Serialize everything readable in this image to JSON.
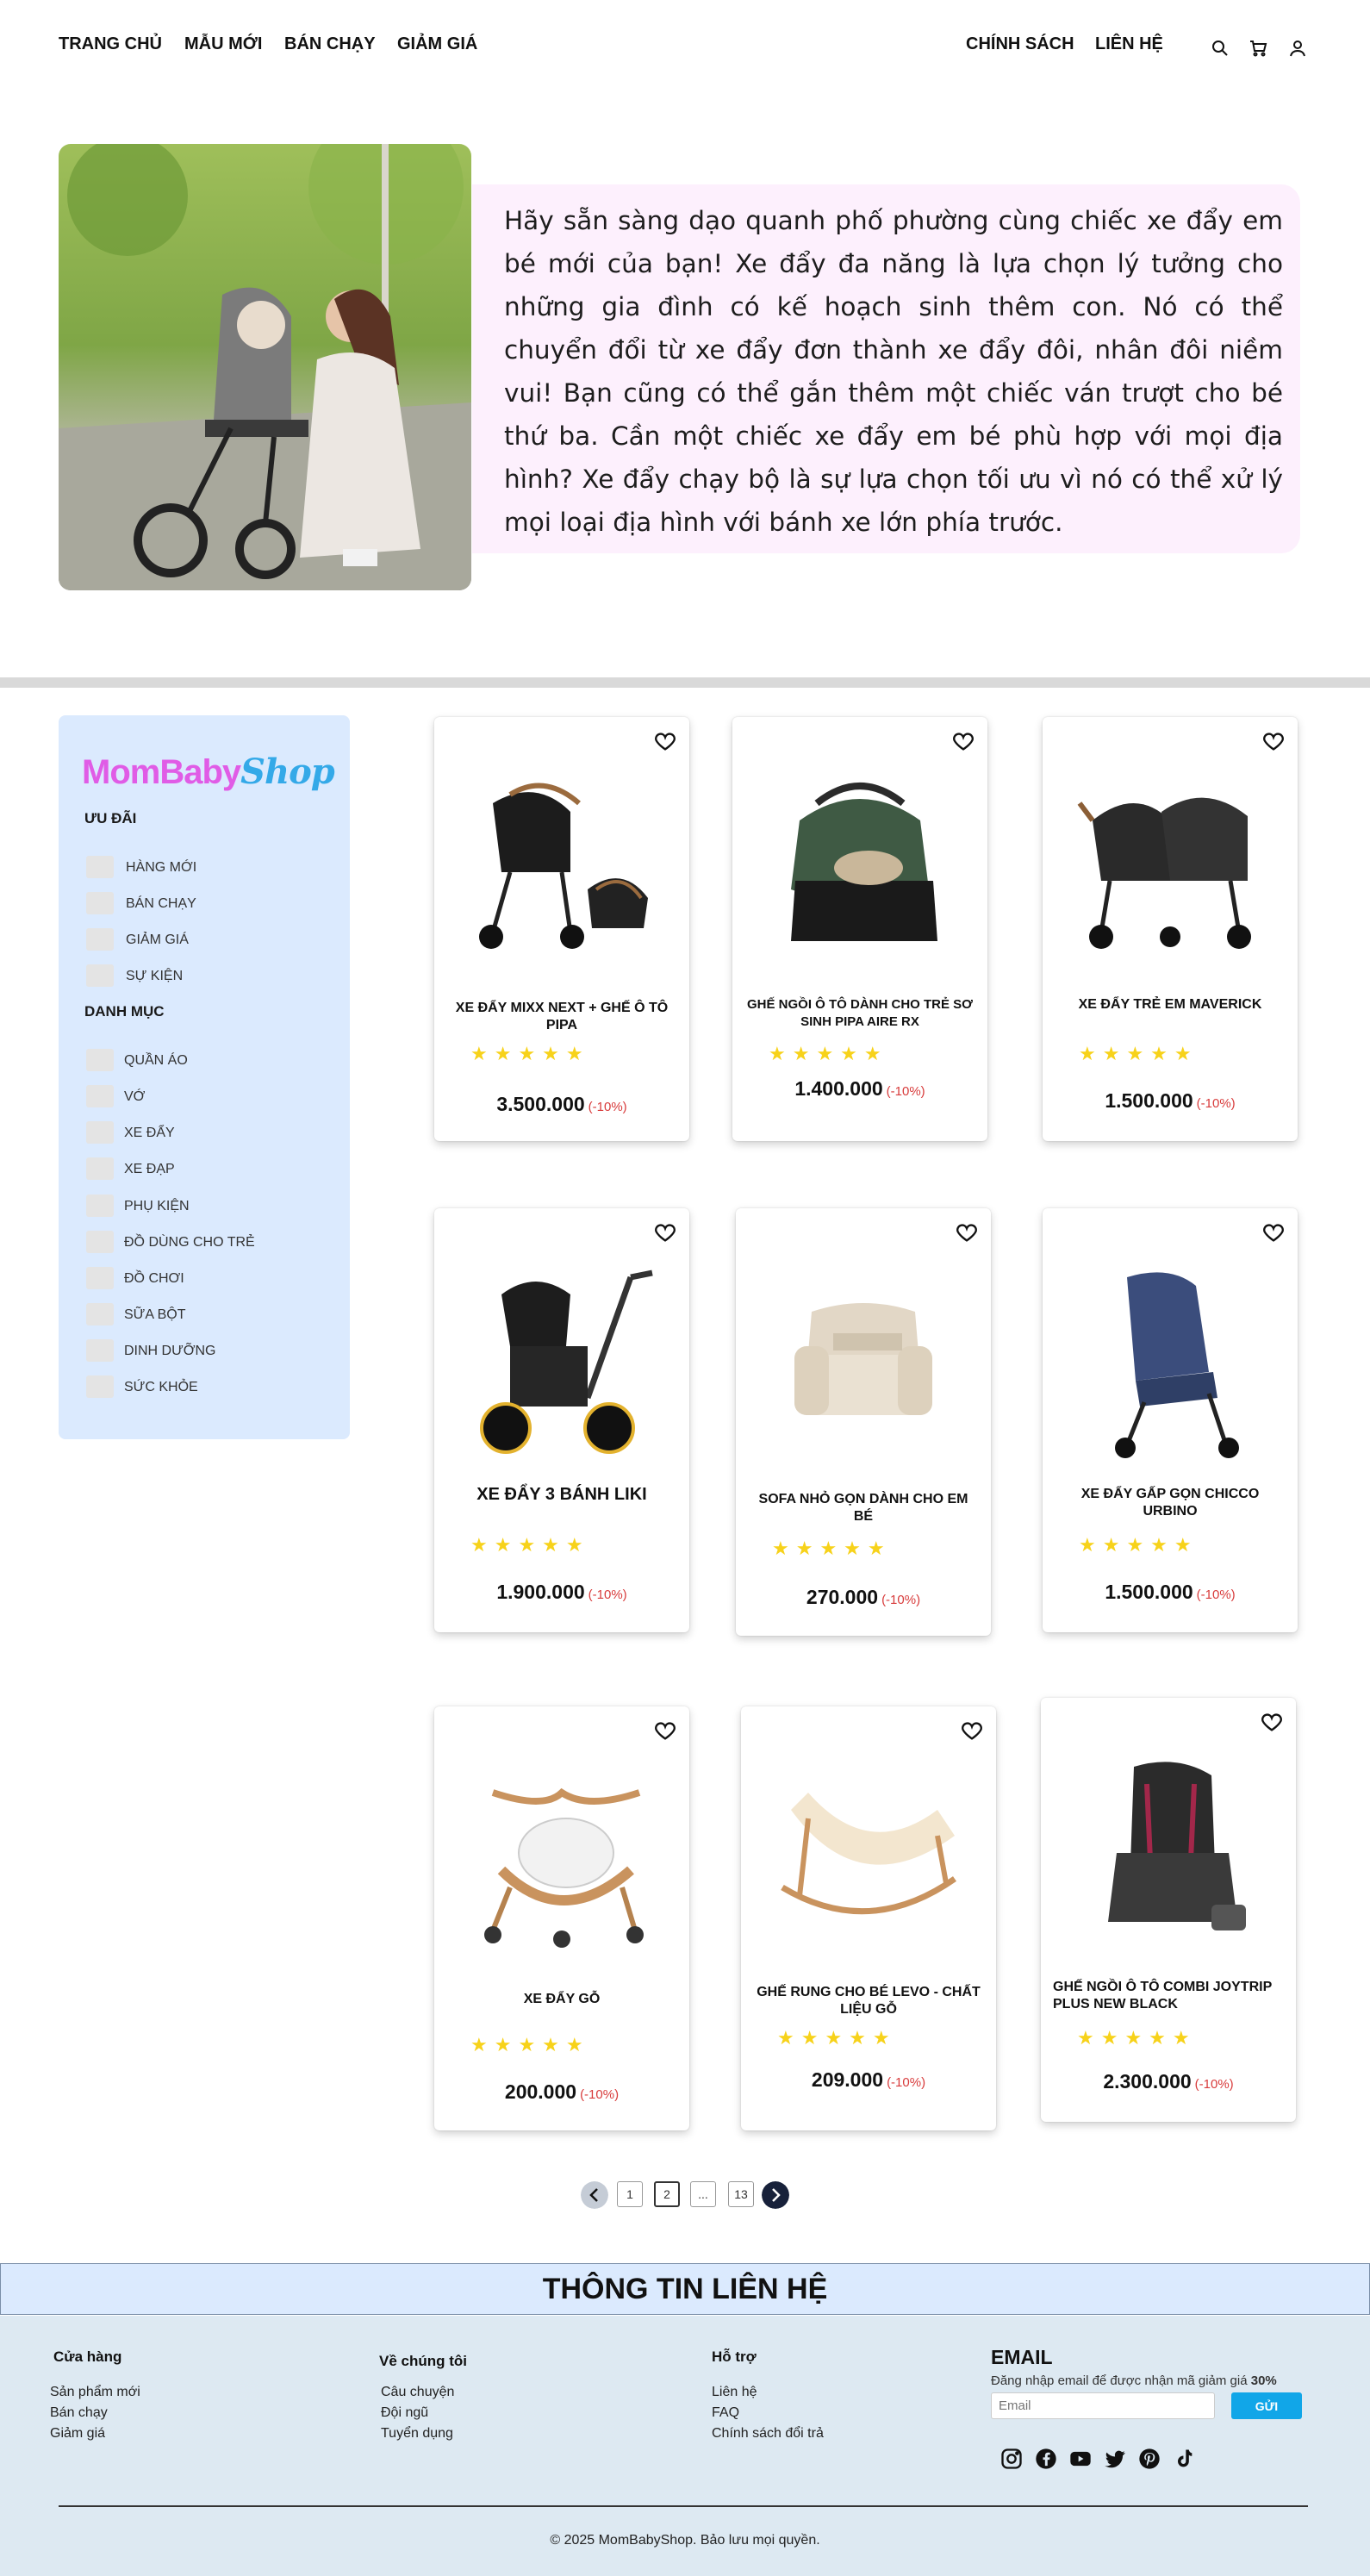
{
  "nav": {
    "left": [
      "TRANG CHỦ",
      "MẪU MỚI",
      "BÁN CHẠY",
      "GIẢM GIÁ"
    ],
    "right": [
      "CHÍNH SÁCH",
      "LIÊN HỆ"
    ],
    "icons": [
      "search-icon",
      "cart-icon",
      "user-icon"
    ]
  },
  "hero": {
    "text": "Hãy sẵn sàng dạo quanh phố phường cùng chiếc xe đẩy em bé mới của bạn! Xe đẩy đa năng là lựa chọn lý tưởng cho những gia đình có kế hoạch sinh thêm con. Nó có thể chuyển đổi từ xe đẩy đơn thành xe đẩy đôi, nhân đôi niềm vui! Bạn cũng có thể gắn thêm một chiếc ván trượt cho bé thứ ba. Cần một chiếc xe đẩy em bé phù hợp với mọi địa hình? Xe đẩy chạy bộ là sự lựa chọn tối ưu vì nó có thể xử lý mọi loại địa hình với bánh xe lớn phía trước."
  },
  "sidebar": {
    "brand_a": "MomBaby",
    "brand_b": "Shop",
    "offers_title": "ƯU ĐÃI",
    "offers": [
      "HÀNG MỚI",
      "BÁN CHẠY",
      "GIẢM GIÁ",
      "SỰ KIỆN"
    ],
    "categories_title": "DANH MỤC",
    "categories": [
      "QUẦN ÁO",
      "VỚ",
      "XE ĐẨY",
      "XE ĐẠP",
      "PHỤ KIỆN",
      "ĐỒ DÙNG CHO TRẺ",
      "ĐỒ CHƠI",
      "SỮA BỘT",
      "DINH DƯỠNG",
      "SỨC KHỎE"
    ]
  },
  "products": [
    {
      "name": "XE ĐẨY MIXX NEXT + GHẾ Ô TÔ PIPA",
      "price": "3.500.000",
      "discount": "(-10%)",
      "rating": 5
    },
    {
      "name": "GHẾ NGỒI Ô TÔ DÀNH CHO TRẺ SƠ SINH PIPA AIRE RX",
      "price": "1.400.000",
      "discount": "(-10%)",
      "rating": 5
    },
    {
      "name": "XE ĐẨY TRẺ EM MAVERICK",
      "price": "1.500.000",
      "discount": "(-10%)",
      "rating": 5
    },
    {
      "name": "XE ĐẨY 3 BÁNH LIKI",
      "price": "1.900.000",
      "discount": "(-10%)",
      "rating": 5
    },
    {
      "name": "SOFA NHỎ GỌN DÀNH CHO EM BÉ",
      "price": "270.000",
      "discount": "(-10%)",
      "rating": 5
    },
    {
      "name": "XE ĐẨY GẤP GỌN CHICCO URBINO",
      "price": "1.500.000",
      "discount": "(-10%)",
      "rating": 5
    },
    {
      "name": "XE ĐẨY GỖ",
      "price": "200.000",
      "discount": "(-10%)",
      "rating": 5
    },
    {
      "name": "GHẾ RUNG CHO BÉ LEVO - CHẤT LIỆU GỖ",
      "price": "209.000",
      "discount": "(-10%)",
      "rating": 5
    },
    {
      "name": "GHẾ NGỒI Ô TÔ COMBI JOYTRIP PLUS NEW BLACK",
      "price": "2.300.000",
      "discount": "(-10%)",
      "rating": 5
    }
  ],
  "pagination": {
    "pages": [
      "1",
      "2",
      "...",
      "13"
    ],
    "current": "2"
  },
  "footer": {
    "contact_title": "THÔNG TIN LIÊN HỆ",
    "col1_title": "Cửa hàng",
    "col1": [
      "Sản phẩm mới",
      "Bán chạy",
      "Giảm giá"
    ],
    "col2_title": "Về chúng tôi",
    "col2": [
      "Câu chuyện",
      "Đội ngũ",
      "Tuyển dụng"
    ],
    "col3_title": "Hỗ trợ",
    "col3": [
      "Liên hệ",
      "FAQ",
      "Chính sách đổi trả"
    ],
    "email_title": "EMAIL",
    "email_desc": "Đăng nhập email để được nhận mã giảm giá",
    "email_desc_bold": "30%",
    "email_placeholder": "Email",
    "email_button": "GỬI",
    "socials": [
      "instagram-icon",
      "facebook-icon",
      "youtube-icon",
      "twitter-icon",
      "pinterest-icon",
      "tiktok-icon"
    ],
    "copyright": "© 2025 MomBabyShop. Bảo lưu mọi quyền."
  },
  "colors": {
    "accent": "#11a6e8",
    "brand_pink": "#e05ce6",
    "brand_blue": "#34a9e8",
    "star": "#f7d21a",
    "discount": "#d83b3b",
    "sidebar_bg": "#dbeafe",
    "hero_bg": "#fdf0fd"
  }
}
